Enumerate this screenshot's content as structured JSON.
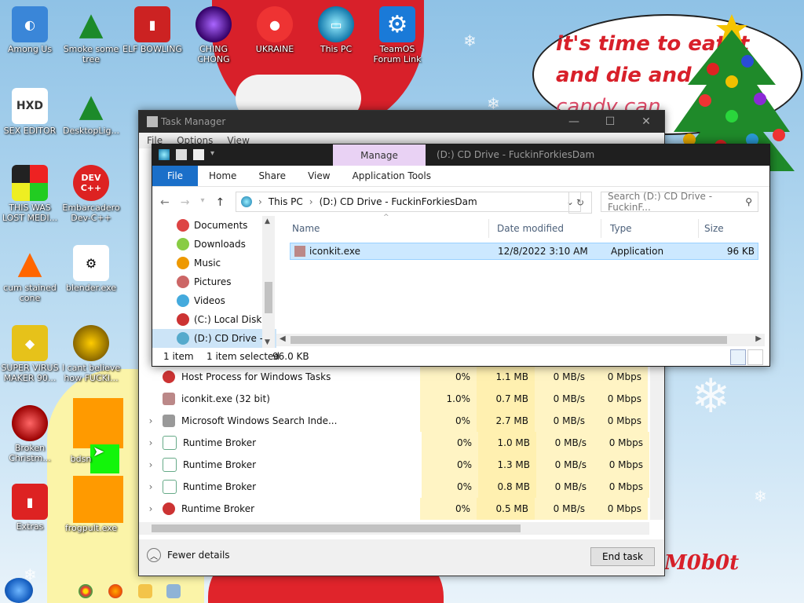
{
  "desktop": {
    "icons": [
      {
        "label": "Among Us"
      },
      {
        "label": "Smoke some tree"
      },
      {
        "label": "ELF BOWLING"
      },
      {
        "label": "CHING CHONG"
      },
      {
        "label": "UKRAINE"
      },
      {
        "label": "This PC"
      },
      {
        "label": "TeamOS Forum Link"
      },
      {
        "label": "SEX EDITOR"
      },
      {
        "label": "DesktopLig..."
      },
      {
        "label": "THIS WAS LOST MEDI..."
      },
      {
        "label": "Embarcadero Dev-C++"
      },
      {
        "label": "cum stained cone"
      },
      {
        "label": "blender.exe"
      },
      {
        "label": "SUPER VIRUS MAKER 90..."
      },
      {
        "label": "I cant believe how FUCKI..."
      },
      {
        "label": "Broken Christm..."
      },
      {
        "label": "Extras"
      },
      {
        "label": "bdsn"
      },
      {
        "label": "frogpult.exe"
      }
    ],
    "icon_text": {
      "hxd": "HXD",
      "devcpp": "DEV C++"
    },
    "bubble": {
      "line1": "it's time to eat it",
      "line2": "and die and c",
      "line3": "candy can"
    },
    "signature": "M0b0t"
  },
  "task_manager": {
    "title": "Task Manager",
    "menu": [
      "File",
      "Options",
      "View"
    ],
    "window_controls": [
      "—",
      "☐",
      "✕"
    ],
    "processes": [
      {
        "name": "Host Process for Windows Tasks",
        "cpu": "0%",
        "memory": "1.1 MB",
        "disk": "0 MB/s",
        "network": "0 Mbps",
        "expandable": false
      },
      {
        "name": "iconkit.exe (32 bit)",
        "cpu": "1.0%",
        "memory": "0.7 MB",
        "disk": "0 MB/s",
        "network": "0 Mbps",
        "expandable": false
      },
      {
        "name": "Microsoft Windows Search Inde...",
        "cpu": "0%",
        "memory": "2.7 MB",
        "disk": "0 MB/s",
        "network": "0 Mbps",
        "expandable": true
      },
      {
        "name": "Runtime Broker",
        "cpu": "0%",
        "memory": "1.0 MB",
        "disk": "0 MB/s",
        "network": "0 Mbps",
        "expandable": true
      },
      {
        "name": "Runtime Broker",
        "cpu": "0%",
        "memory": "1.3 MB",
        "disk": "0 MB/s",
        "network": "0 Mbps",
        "expandable": true
      },
      {
        "name": "Runtime Broker",
        "cpu": "0%",
        "memory": "0.8 MB",
        "disk": "0 MB/s",
        "network": "0 Mbps",
        "expandable": true
      },
      {
        "name": "Runtime Broker",
        "cpu": "0%",
        "memory": "0.5 MB",
        "disk": "0 MB/s",
        "network": "0 Mbps",
        "expandable": true
      }
    ],
    "fewer_details": "Fewer details",
    "end_task": "End task"
  },
  "explorer": {
    "title": "(D:) CD Drive - FuckinForkiesDam",
    "manage_tab": "Manage",
    "ribbon_tabs": [
      "File",
      "Home",
      "Share",
      "View",
      "Application Tools"
    ],
    "address": {
      "root": "This PC",
      "current": "(D:) CD Drive - FuckinForkiesDam"
    },
    "search_placeholder": "Search (D:) CD Drive - FuckinF...",
    "nav_items": [
      {
        "label": "Documents",
        "color": "#d44"
      },
      {
        "label": "Downloads",
        "color": "#8c4"
      },
      {
        "label": "Music",
        "color": "#e90"
      },
      {
        "label": "Pictures",
        "color": "#c66"
      },
      {
        "label": "Videos",
        "color": "#4ad"
      },
      {
        "label": "(C:) Local Disk",
        "color": "#c33"
      },
      {
        "label": "(D:) CD Drive - F",
        "color": "#5ac"
      }
    ],
    "columns": {
      "name": "Name",
      "date": "Date modified",
      "type": "Type",
      "size": "Size"
    },
    "files": [
      {
        "name": "iconkit.exe",
        "date": "12/8/2022 3:10 AM",
        "type": "Application",
        "size": "96 KB"
      }
    ],
    "status": {
      "count": "1 item",
      "selected": "1 item selected",
      "size": "96.0 KB"
    }
  },
  "colors": {
    "accent": "#1a6fc9",
    "manage": "#e9d2f4",
    "selection": "#cce8ff"
  }
}
